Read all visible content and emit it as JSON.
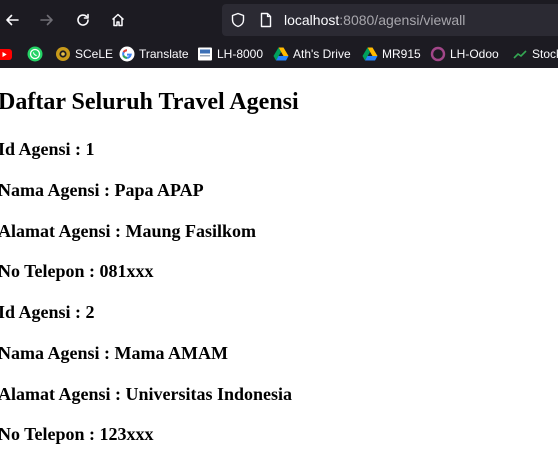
{
  "browser": {
    "url_host": "localhost",
    "url_rest": ":8080/agensi/viewall",
    "bookmarks": [
      {
        "label": "",
        "icon": "youtube-icon"
      },
      {
        "label": "",
        "icon": "whatsapp-icon"
      },
      {
        "label": "SCeLE",
        "icon": "scele-icon"
      },
      {
        "label": "Translate",
        "icon": "google-icon"
      },
      {
        "label": "LH-8000",
        "icon": "lh-icon"
      },
      {
        "label": "Ath's Drive",
        "icon": "drive-icon"
      },
      {
        "label": "MR915",
        "icon": "drive-icon"
      },
      {
        "label": "LH-Odoo",
        "icon": "odoo-icon"
      },
      {
        "label": "Stock",
        "icon": "stock-icon"
      }
    ]
  },
  "page": {
    "title": "Daftar Seluruh Travel Agensi",
    "agencies": [
      {
        "id": "Id Agensi : 1",
        "nama": "Nama Agensi : Papa APAP",
        "alamat": "Alamat Agensi : Maung Fasilkom",
        "telepon": "No Telepon : 081xxx"
      },
      {
        "id": "Id Agensi : 2",
        "nama": "Nama Agensi : Mama AMAM",
        "alamat": "Alamat Agensi : Universitas Indonesia",
        "telepon": "No Telepon : 123xxx"
      }
    ]
  },
  "colors": {
    "toolbar_bg": "#1c1b22",
    "urlbar_bg": "#2b2a33",
    "page_bg": "#ffffff"
  }
}
